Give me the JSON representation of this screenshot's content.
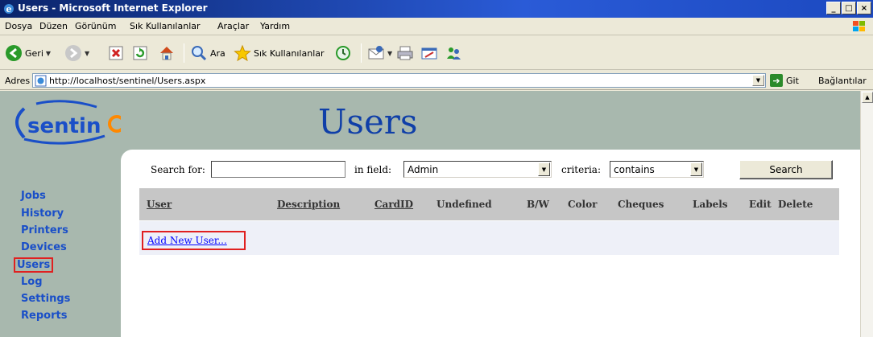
{
  "window": {
    "title": "Users - Microsoft Internet Explorer"
  },
  "menu": [
    "Dosya",
    "Düzen",
    "Görünüm",
    "Sık Kullanılanlar",
    "Araçlar",
    "Yardım"
  ],
  "toolbar": {
    "back": "Geri",
    "search": "Ara",
    "favorites": "Sık Kullanılanlar"
  },
  "address": {
    "label": "Adres",
    "url": "http://localhost/sentinel/Users.aspx",
    "go": "Git",
    "links": "Bağlantılar"
  },
  "page": {
    "logo": "sentinel",
    "title": "Users",
    "search": {
      "label": "Search for:",
      "value": "",
      "field_label": "in field:",
      "field_value": "Admin",
      "criteria_label": "criteria:",
      "criteria_value": "contains",
      "button": "Search"
    },
    "columns": [
      "User",
      "Description",
      "CardID",
      "Undefined",
      "B/W",
      "Color",
      "Cheques",
      "Labels",
      "Edit",
      "Delete"
    ],
    "add_link": "Add New User...",
    "nav": [
      "Jobs",
      "History",
      "Printers",
      "Devices",
      "Users",
      "Log",
      "Settings",
      "Reports"
    ]
  },
  "colors": {
    "nav_link": "#1a4fc8",
    "title": "#0f3fa8",
    "band": "#a8b8ae",
    "highlight": "#e02020"
  }
}
